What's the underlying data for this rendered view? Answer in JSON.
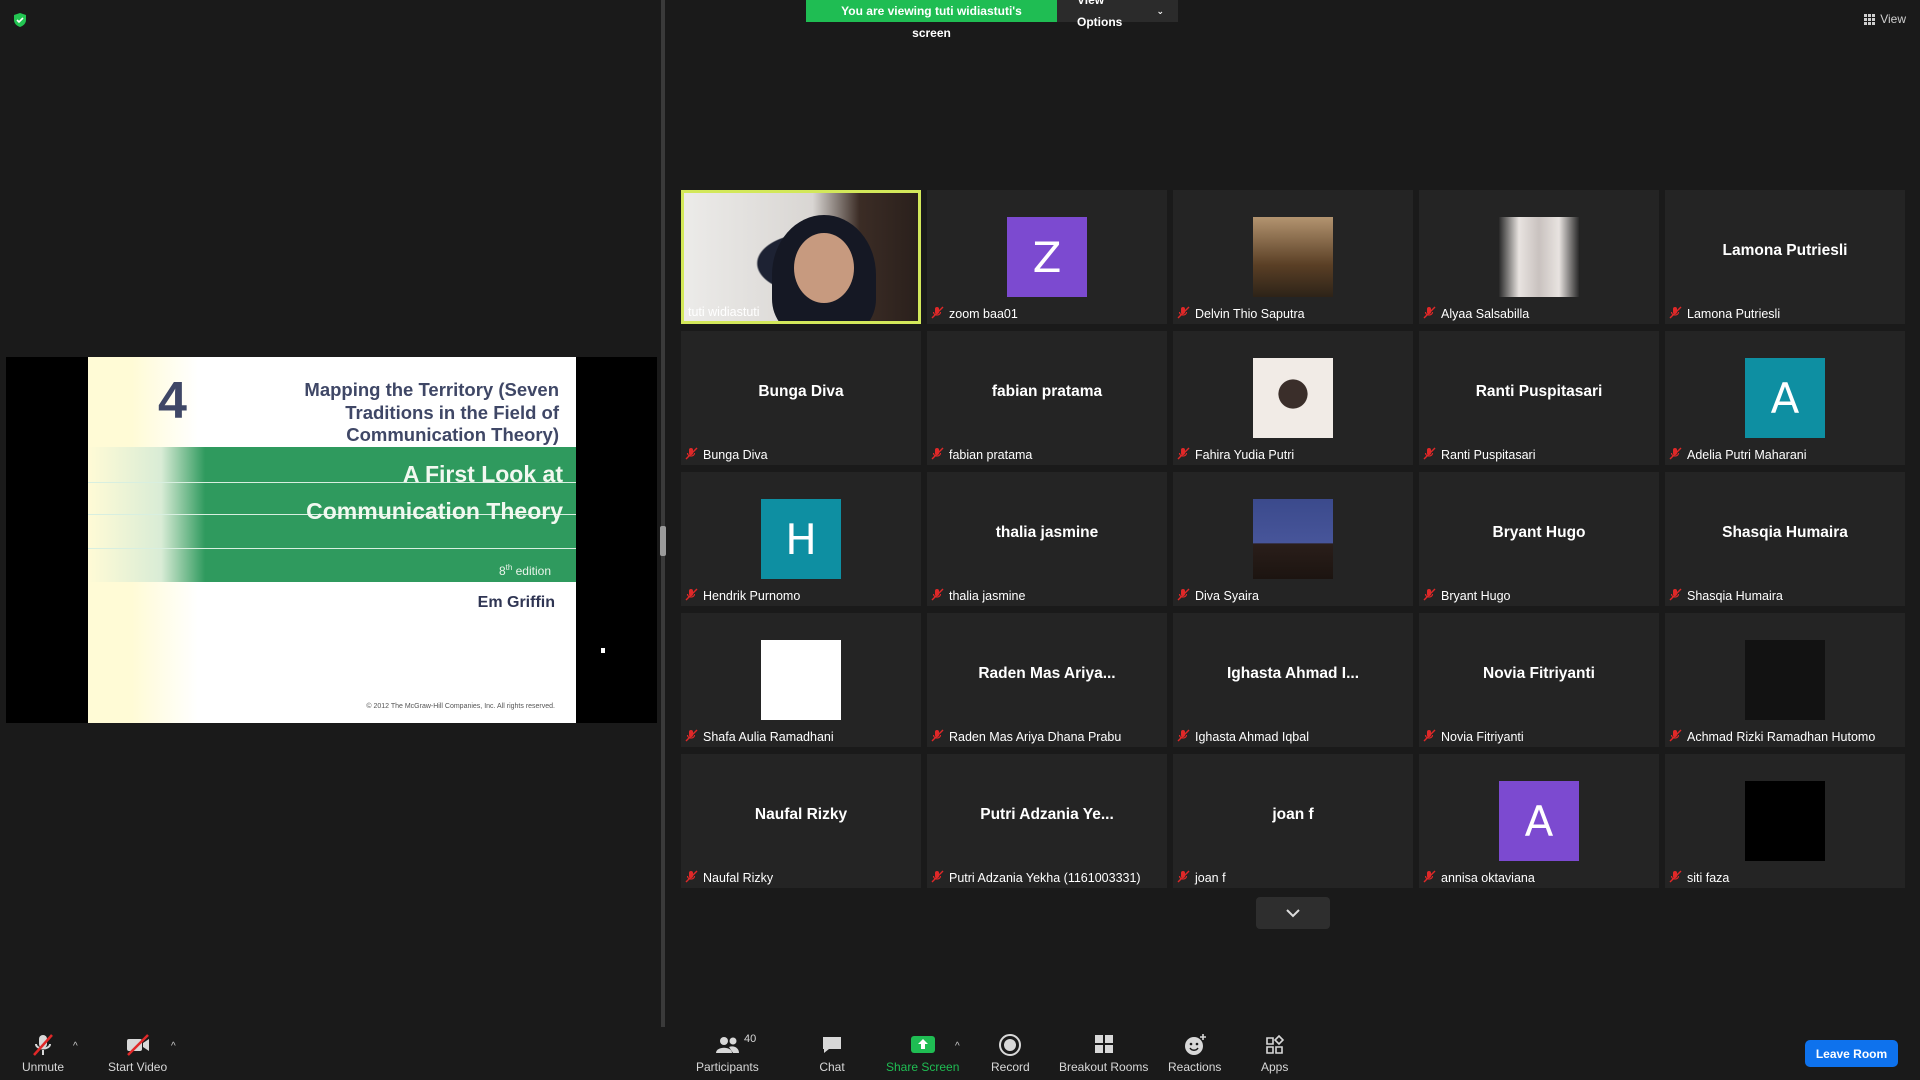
{
  "banner": {
    "viewing": "You are viewing tuti widiastuti's screen",
    "options": "View Options"
  },
  "top_right": {
    "view": "View"
  },
  "slide": {
    "number": "4",
    "subtitle": "Mapping the Territory (Seven Traditions in the Field of Communication Theory)",
    "title_line1": "A First Look at",
    "title_line2": "Communication Theory",
    "edition_num": "8",
    "edition_sup": "th",
    "edition_word": " edition",
    "author": "Em Griffin",
    "copyright": "© 2012 The McGraw-Hill Companies, Inc. All rights reserved."
  },
  "participants": [
    {
      "label": "tuti widiastuti",
      "display": "",
      "kind": "video",
      "muted": false,
      "active": true
    },
    {
      "label": "zoom baa01",
      "display": "Z",
      "kind": "letter",
      "color": "purple",
      "muted": true
    },
    {
      "label": "Delvin Thio Saputra",
      "display": "",
      "kind": "photo",
      "photo": "photo1",
      "muted": true
    },
    {
      "label": "Alyaa Salsabilla",
      "display": "",
      "kind": "photo",
      "photo": "photo2",
      "muted": true
    },
    {
      "label": "Lamona Putriesli",
      "display": "Lamona Putriesli",
      "kind": "name",
      "muted": true
    },
    {
      "label": "Bunga Diva",
      "display": "Bunga Diva",
      "kind": "name",
      "muted": true
    },
    {
      "label": "fabian pratama",
      "display": "fabian pratama",
      "kind": "name",
      "muted": true
    },
    {
      "label": "Fahira Yudia Putri",
      "display": "",
      "kind": "photo",
      "photo": "photo3",
      "muted": true
    },
    {
      "label": "Ranti Puspitasari",
      "display": "Ranti Puspitasari",
      "kind": "name",
      "muted": true
    },
    {
      "label": "Adelia Putri Maharani",
      "display": "A",
      "kind": "letter",
      "color": "teal",
      "muted": true
    },
    {
      "label": "Hendrik Purnomo",
      "display": "H",
      "kind": "letter",
      "color": "teal",
      "muted": true
    },
    {
      "label": "thalia jasmine",
      "display": "thalia jasmine",
      "kind": "name",
      "muted": true
    },
    {
      "label": "Diva Syaira",
      "display": "",
      "kind": "photo",
      "photo": "photo4",
      "muted": true
    },
    {
      "label": "Bryant Hugo",
      "display": "Bryant Hugo",
      "kind": "name",
      "muted": true
    },
    {
      "label": "Shasqia Humaira",
      "display": "Shasqia Humaira",
      "kind": "name",
      "muted": true
    },
    {
      "label": "Shafa Aulia Ramadhani",
      "display": "",
      "kind": "photo",
      "photo": "white",
      "muted": true
    },
    {
      "label": "Raden Mas Ariya Dhana Prabu",
      "display": "Raden Mas Ariya...",
      "kind": "name",
      "muted": true
    },
    {
      "label": "Ighasta Ahmad Iqbal",
      "display": "Ighasta Ahmad I...",
      "kind": "name",
      "muted": true
    },
    {
      "label": "Novia Fitriyanti",
      "display": "Novia Fitriyanti",
      "kind": "name",
      "muted": true
    },
    {
      "label": "Achmad Rizki Ramadhan Hutomo",
      "display": "",
      "kind": "photo",
      "photo": "dark",
      "muted": true
    },
    {
      "label": "Naufal Rizky",
      "display": "Naufal Rizky",
      "kind": "name",
      "muted": true
    },
    {
      "label": "Putri Adzania Yekha (1161003331)",
      "display": "Putri Adzania Ye...",
      "kind": "name",
      "muted": true
    },
    {
      "label": "joan f",
      "display": "joan f",
      "kind": "name",
      "muted": true
    },
    {
      "label": "annisa oktaviana",
      "display": "A",
      "kind": "letter",
      "color": "purple",
      "muted": true
    },
    {
      "label": "siti faza",
      "display": "",
      "kind": "photo",
      "photo": "black",
      "muted": true
    }
  ],
  "toolbar": {
    "unmute": "Unmute",
    "start_video": "Start Video",
    "participants": "Participants",
    "participant_count": "40",
    "chat": "Chat",
    "share_screen": "Share Screen",
    "record": "Record",
    "breakout_rooms": "Breakout Rooms",
    "reactions": "Reactions",
    "apps": "Apps",
    "leave": "Leave Room"
  },
  "colors": {
    "share_green": "#1fbd53",
    "leave_blue": "#0e72ed",
    "active_border": "#d3e85a",
    "mute_red": "#e02828"
  }
}
